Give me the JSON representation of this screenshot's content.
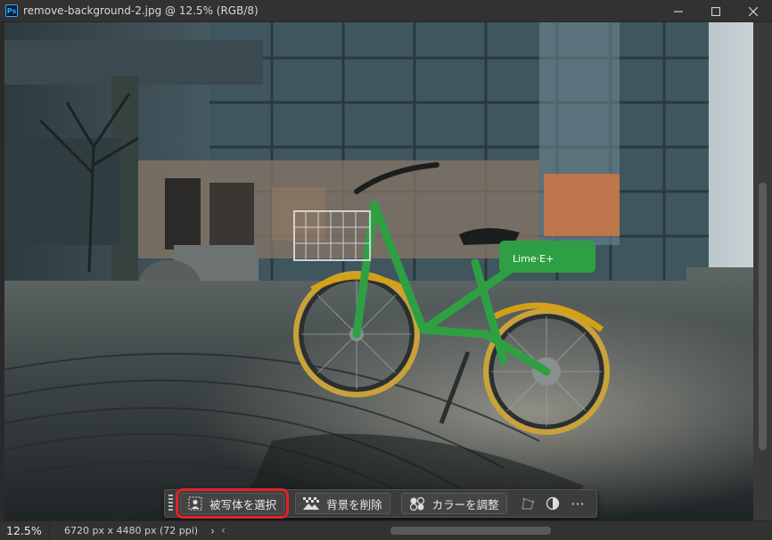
{
  "window": {
    "app_badge": "Ps",
    "title": "remove-background-2.jpg @ 12.5% (RGB/8)",
    "controls": [
      "minimize",
      "maximize",
      "close"
    ]
  },
  "canvas": {
    "scene_text": {
      "brand_tag": "Lime·E+"
    }
  },
  "taskbar": {
    "select_subject_label": "被写体を選択",
    "remove_background_label": "背景を削除",
    "adjust_color_label": "カラーを調整",
    "more_label": "···",
    "icons": [
      "select-subject-icon",
      "remove-background-icon",
      "adjust-color-icon",
      "shape-icon",
      "contrast-icon",
      "more-icon"
    ]
  },
  "status": {
    "zoom": "12.5%",
    "doc_info": "6720 px x 4480 px (72 ppi)",
    "expand_arrow": "›",
    "scroll_left": "‹"
  },
  "colors": {
    "chrome": "#323232",
    "highlight": "#e5212b",
    "bike_frame": "#2ea043",
    "tire_accent": "#d4a017"
  }
}
